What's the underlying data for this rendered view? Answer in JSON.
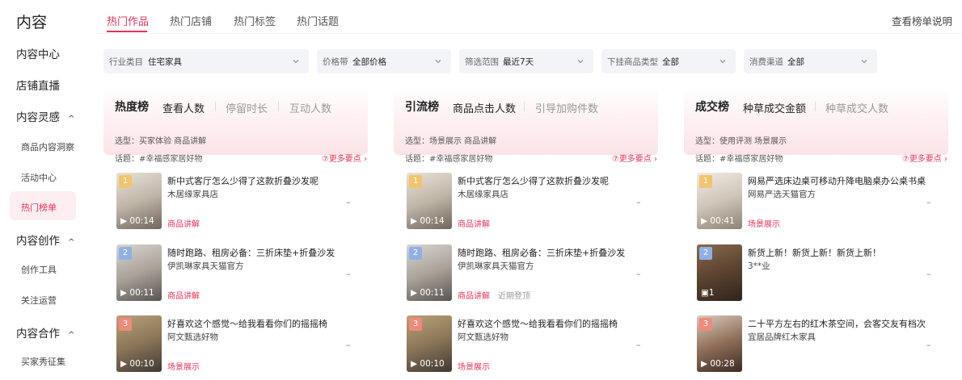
{
  "sidebar": {
    "title": "内容",
    "items": [
      {
        "label": "内容中心",
        "level": "top"
      },
      {
        "label": "店铺直播",
        "level": "top"
      },
      {
        "label": "内容灵感",
        "level": "top",
        "caret": "^"
      },
      {
        "label": "商品内容洞察",
        "level": "sub"
      },
      {
        "label": "活动中心",
        "level": "sub"
      },
      {
        "label": "热门榜单",
        "level": "sub",
        "active": true
      },
      {
        "label": "内容创作",
        "level": "top",
        "caret": "^"
      },
      {
        "label": "创作工具",
        "level": "sub"
      },
      {
        "label": "关注运营",
        "level": "sub"
      },
      {
        "label": "内容合作",
        "level": "top",
        "caret": "^"
      },
      {
        "label": "买家秀征集",
        "level": "sub"
      }
    ]
  },
  "top_tabs": [
    {
      "label": "热门作品",
      "active": true
    },
    {
      "label": "热门店铺"
    },
    {
      "label": "热门标签"
    },
    {
      "label": "热门话题"
    }
  ],
  "help_link": "查看榜单说明",
  "filters": [
    {
      "label": "行业类目",
      "value": "住宅家具"
    },
    {
      "label": "价格带",
      "value": "全部价格"
    },
    {
      "label": "筛选范围",
      "value": "最近7天"
    },
    {
      "label": "下挂商品类型",
      "value": "全部"
    },
    {
      "label": "消费渠道",
      "value": "全部"
    }
  ],
  "panels": [
    {
      "title": "热度榜",
      "tabs": [
        "查看人数",
        "停留时长",
        "互动人数"
      ],
      "selection_line": "选型：买家体验 商品讲解",
      "topic_line": "话题：#幸福感家居好物",
      "more": "更多要点",
      "items": [
        {
          "rank": "1",
          "duration": "00:14",
          "title": "新中式客厅怎么少得了这款折叠沙发呢",
          "shop": "木居缘家具店",
          "tag": "商品讲解",
          "tag2": "",
          "value": "–"
        },
        {
          "rank": "2",
          "duration": "00:11",
          "title": "随时跑路、租房必备：三折床垫+折叠沙发",
          "shop": "伊凯琳家具天猫官方",
          "tag": "商品讲解",
          "tag2": "",
          "value": "–"
        },
        {
          "rank": "3",
          "duration": "00:10",
          "title": "好喜欢这个感觉～给我看看你们的摇摇椅",
          "shop": "阿文甄选好物",
          "tag": "场景展示",
          "tag2": "",
          "value": "–"
        }
      ]
    },
    {
      "title": "引流榜",
      "tabs": [
        "商品点击人数",
        "引导加购件数"
      ],
      "selection_line": "选型：场景展示 商品讲解",
      "topic_line": "话题：#幸福感家居好物",
      "more": "更多要点",
      "items": [
        {
          "rank": "1",
          "duration": "00:14",
          "title": "新中式客厅怎么少得了这款折叠沙发呢",
          "shop": "木居缘家具店",
          "tag": "商品讲解",
          "tag2": "",
          "value": "–"
        },
        {
          "rank": "2",
          "duration": "00:11",
          "title": "随时跑路、租房必备：三折床垫+折叠沙发",
          "shop": "伊凯琳家具天猫官方",
          "tag": "商品讲解",
          "tag2": "近期登顶",
          "value": "–"
        },
        {
          "rank": "3",
          "duration": "00:10",
          "title": "好喜欢这个感觉～给我看看你们的摇摇椅",
          "shop": "阿文甄选好物",
          "tag": "场景展示",
          "tag2": "",
          "value": "–"
        }
      ]
    },
    {
      "title": "成交榜",
      "tabs": [
        "种草成交金额",
        "种草成交人数"
      ],
      "selection_line": "选型：使用评测 场景展示",
      "topic_line": "话题：#幸福感家居好物",
      "more": "更多要点",
      "items": [
        {
          "rank": "1",
          "duration": "00:41",
          "title": "网易严选床边桌可移动升降电脑桌办公桌书桌",
          "shop": "网易严选天猫官方",
          "tag": "场景展示",
          "tag2": "",
          "value": "–"
        },
        {
          "rank": "2",
          "duration": "1",
          "title": "新货上新！新货上新！新货上新！",
          "shop": "3**业",
          "tag": "",
          "tag2": "",
          "value": "–"
        },
        {
          "rank": "3",
          "duration": "00:28",
          "title": "二十平方左右的红木茶空间，会客交友有档次",
          "shop": "宜居品牌红木家具",
          "tag": "",
          "tag2": "",
          "value": "–"
        }
      ]
    }
  ],
  "colors": {
    "accent": "#e8325a",
    "rank1": "#f2c46d",
    "rank2": "#8fb0e6",
    "rank3": "#f08a7a"
  }
}
